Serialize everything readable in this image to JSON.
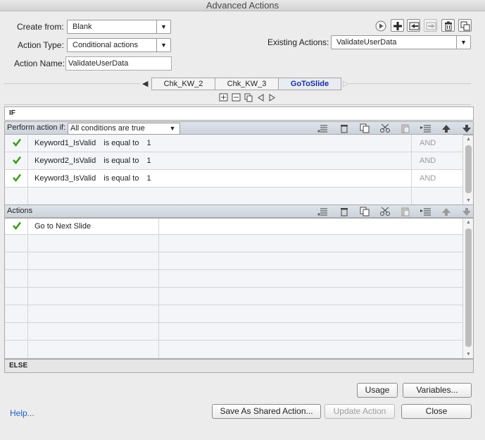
{
  "window": {
    "title": "Advanced Actions"
  },
  "form": {
    "create_from_label": "Create from:",
    "create_from_value": "Blank",
    "action_type_label": "Action Type:",
    "action_type_value": "Conditional actions",
    "action_name_label": "Action Name:",
    "action_name_value": "ValidateUserData",
    "existing_actions_label": "Existing Actions:",
    "existing_actions_value": "ValidateUserData"
  },
  "tabs": [
    {
      "label": "Chk_KW_2",
      "active": false
    },
    {
      "label": "Chk_KW_3",
      "active": false
    },
    {
      "label": "GoToSlide",
      "active": true
    }
  ],
  "if_section": {
    "title": "IF",
    "perform_label": "Perform action if:",
    "perform_value": "All conditions are true",
    "rows": [
      {
        "checked": true,
        "variable": "Keyword1_IsValid",
        "operator": "is equal to",
        "value": "1",
        "logic": "AND"
      },
      {
        "checked": true,
        "variable": "Keyword2_IsValid",
        "operator": "is equal to",
        "value": "1",
        "logic": "AND"
      },
      {
        "checked": true,
        "variable": "Keyword3_IsValid",
        "operator": "is equal to",
        "value": "1",
        "logic": "AND"
      }
    ]
  },
  "actions_section": {
    "title": "Actions",
    "rows": [
      {
        "checked": true,
        "action": "Go to Next Slide"
      }
    ]
  },
  "else_section": {
    "title": "ELSE"
  },
  "buttons": {
    "usage": "Usage",
    "variables": "Variables...",
    "save_shared": "Save As Shared Action...",
    "update": "Update Action",
    "close": "Close",
    "help": "Help..."
  },
  "colors": {
    "accent_tab": "#1a2f9c",
    "check": "#3a9a1c",
    "help_link": "#1f5fbf"
  }
}
